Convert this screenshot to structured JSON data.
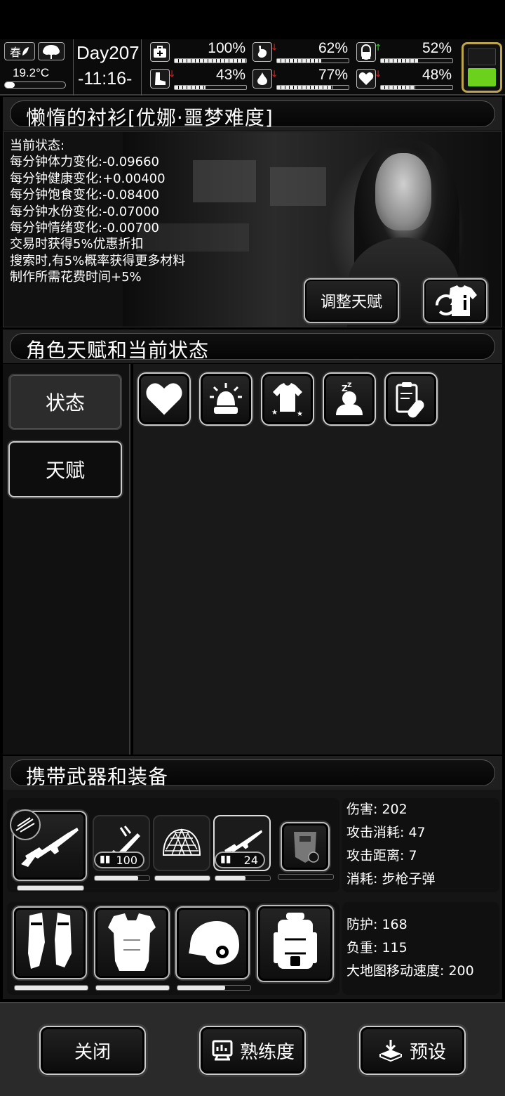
{
  "topbar": {
    "season": "春",
    "temperature": "19.2°C",
    "day": "Day207",
    "time": "-11:16-",
    "stats": [
      {
        "name": "health",
        "icon": "medkit-icon",
        "value": "100%",
        "fill": 1.0,
        "trend": "none"
      },
      {
        "name": "hunger",
        "icon": "stomach-icon",
        "value": "62%",
        "fill": 0.62,
        "trend": "down"
      },
      {
        "name": "pill",
        "icon": "pill-icon",
        "value": "52%",
        "fill": 0.52,
        "trend": "up"
      },
      {
        "name": "stamina",
        "icon": "boot-icon",
        "value": "43%",
        "fill": 0.43,
        "trend": "down"
      },
      {
        "name": "water",
        "icon": "water-drop-icon",
        "value": "77%",
        "fill": 0.77,
        "trend": "down"
      },
      {
        "name": "mood",
        "icon": "heart-icon",
        "value": "48%",
        "fill": 0.48,
        "trend": "down"
      }
    ],
    "battery_fill": 0.4,
    "colors": {
      "up": "#1fd21f",
      "down": "#e01515",
      "battery": "#6bd11a"
    }
  },
  "character": {
    "title": "懒惰的衬衫[优娜·噩梦难度]",
    "status_lines": [
      "当前状态:",
      "每分钟体力变化:-0.09660",
      "每分钟健康变化:+0.00400",
      "每分钟饱食变化:-0.08400",
      "每分钟水份变化:-0.07000",
      "每分钟情绪变化:-0.00700",
      "交易时获得5%优惠折扣",
      "搜索时,有5%概率获得更多材料",
      "制作所需花费时间+5%"
    ],
    "adjust_talent_label": "调整天赋"
  },
  "talents": {
    "title": "角色天赋和当前状态",
    "tabs": {
      "state": "状态",
      "talent": "天赋"
    },
    "status_icons": [
      "heart-icon",
      "alarm-icon",
      "shirt-icon",
      "sleep-icon",
      "medicine-icon"
    ]
  },
  "equipment": {
    "title": "携带武器和装备",
    "weapons": [
      {
        "icon": "rifle-icon",
        "durability": 1.0
      },
      {
        "icon": "minigun-icon",
        "ammo": "100",
        "durability": 0.8
      },
      {
        "icon": "net-icon",
        "durability": 1.0
      },
      {
        "icon": "rifle-icon",
        "ammo": "24",
        "durability": 0.55
      },
      {
        "icon": "riot-shield-icon",
        "durability": 0
      }
    ],
    "weapon_stats": [
      "伤害: 202",
      "攻击消耗: 47",
      "攻击距离: 7",
      "消耗: 步枪子弹"
    ],
    "armor": [
      {
        "icon": "arm-guards-icon",
        "durability": 1.0
      },
      {
        "icon": "body-armor-icon",
        "durability": 1.0
      },
      {
        "icon": "helmet-icon",
        "durability": 0.65
      },
      {
        "icon": "backpack-icon",
        "durability": null
      }
    ],
    "armor_stats": [
      "防护: 168",
      "负重: 115",
      "大地图移动速度: 200"
    ]
  },
  "bottom": {
    "close": "关闭",
    "proficiency": "熟练度",
    "preset": "预设"
  }
}
